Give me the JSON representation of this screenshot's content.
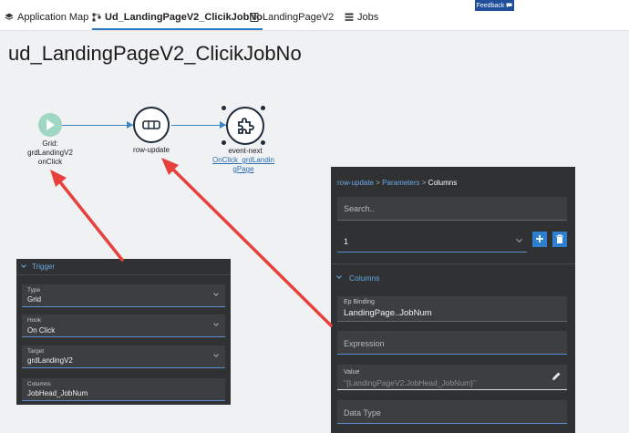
{
  "tabs": [
    {
      "label": "Application Map",
      "icon": "app-map-icon"
    },
    {
      "label": "Ud_LandingPageV2_ClicikJobNo",
      "icon": "workflow-icon",
      "active": true
    },
    {
      "label": "LandingPageV2",
      "icon": "page-icon"
    },
    {
      "label": "Jobs",
      "icon": "grid-icon"
    }
  ],
  "feedback_label": "Feedback",
  "page_title": "ud_LandingPageV2_ClicikJobNo",
  "flow": {
    "trigger_node": {
      "label_line1": "Grid:",
      "label_line2": "grdLandingV2",
      "label_line3": "onClick",
      "icon": "play-icon"
    },
    "row_update_node": {
      "label": "row-update",
      "icon": "row-update-icon"
    },
    "event_next_node": {
      "label": "event-next",
      "link_line1": "OnClick_grdLandin",
      "link_line2": "gPage",
      "icon": "puzzle-icon"
    }
  },
  "trigger_panel": {
    "header": "Trigger",
    "fields": [
      {
        "label": "Type",
        "value": "Grid",
        "dropdown": true
      },
      {
        "label": "Hook",
        "value": "On Click",
        "dropdown": true
      },
      {
        "label": "Target",
        "value": "grdLandingV2",
        "dropdown": true
      },
      {
        "label": "Columns",
        "value": "JobHead_JobNum",
        "dropdown": false
      }
    ]
  },
  "props_panel": {
    "breadcrumb": [
      "row-update",
      "Parameters",
      "Columns"
    ],
    "search_placeholder": "Search..",
    "selector_value": "1",
    "columns_header": "Columns",
    "ep_binding_label": "Ep Binding",
    "ep_binding_value": "LandingPage..JobNum",
    "expression_placeholder": "Expression",
    "value_label": "Value",
    "value_value": "\"{LandingPageV2.JobHead_JobNum}\"",
    "data_type_placeholder": "Data Type"
  },
  "colors": {
    "accent": "#2a7abf",
    "arrow": "#e8413c",
    "panel": "#2f3133",
    "trigger_node": "#9fd7c2"
  }
}
